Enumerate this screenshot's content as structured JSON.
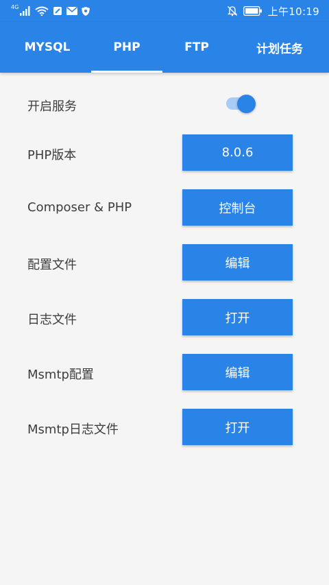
{
  "status_bar": {
    "signal_label": "4G",
    "time": "上午10:19"
  },
  "tabs": [
    {
      "label": "MYSQL"
    },
    {
      "label": "PHP",
      "selected": true
    },
    {
      "label": "FTP"
    },
    {
      "label": "计划任务"
    }
  ],
  "service": {
    "label": "开启服务",
    "enabled": true
  },
  "rows": [
    {
      "label": "PHP版本",
      "button": "8.0.6"
    },
    {
      "label": "Composer & PHP",
      "button": "控制台"
    },
    {
      "label": "配置文件",
      "button": "编辑"
    },
    {
      "label": "日志文件",
      "button": "打开"
    },
    {
      "label": "Msmtp配置",
      "button": "编辑"
    },
    {
      "label": "Msmtp日志文件",
      "button": "打开"
    }
  ],
  "colors": {
    "primary": "#2a84e8",
    "background": "#f5f5f5",
    "text": "#3d3d3d",
    "toggle_track": "#a7cdf6"
  }
}
